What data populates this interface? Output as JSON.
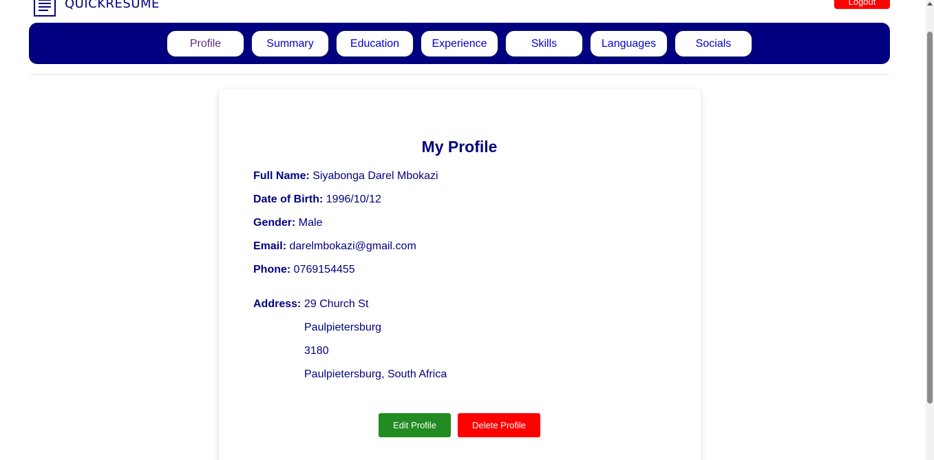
{
  "header": {
    "logo_text": "QUICKRESUME",
    "logout_label": "Logout"
  },
  "nav": {
    "tabs": [
      {
        "label": "Profile",
        "active": true
      },
      {
        "label": "Summary",
        "active": false
      },
      {
        "label": "Education",
        "active": false
      },
      {
        "label": "Experience",
        "active": false
      },
      {
        "label": "Skills",
        "active": false
      },
      {
        "label": "Languages",
        "active": false
      },
      {
        "label": "Socials",
        "active": false
      }
    ]
  },
  "profile": {
    "title": "My Profile",
    "fields": [
      {
        "label": "Full Name:",
        "value": "Siyabonga Darel Mbokazi"
      },
      {
        "label": "Date of Birth:",
        "value": "1996/10/12"
      },
      {
        "label": "Gender:",
        "value": "Male"
      },
      {
        "label": "Email:",
        "value": "darelmbokazi@gmail.com"
      },
      {
        "label": "Phone:",
        "value": "0769154455"
      }
    ],
    "address": {
      "label": "Address:",
      "lines": [
        "29 Church St",
        "Paulpietersburg",
        "3180",
        "Paulpietersburg, South Africa"
      ]
    },
    "actions": {
      "edit_label": "Edit Profile",
      "delete_label": "Delete Profile"
    }
  },
  "colors": {
    "brand": "#000080",
    "edit": "#228b22",
    "danger": "#ff0000"
  }
}
